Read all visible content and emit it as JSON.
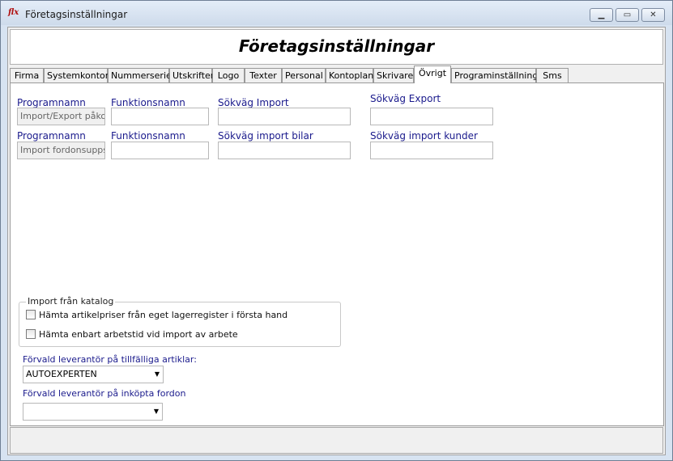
{
  "window": {
    "title": "Företagsinställningar",
    "icon_text": "flx"
  },
  "header": {
    "title": "Företagsinställningar"
  },
  "tabs": [
    {
      "label": "Firma"
    },
    {
      "label": "Systemkonton"
    },
    {
      "label": "Nummerserier"
    },
    {
      "label": "Utskrifter"
    },
    {
      "label": "Logo"
    },
    {
      "label": "Texter"
    },
    {
      "label": "Personal"
    },
    {
      "label": "Kontoplan"
    },
    {
      "label": "Skrivare"
    },
    {
      "label": "Övrigt"
    },
    {
      "label": "Programinställningar"
    },
    {
      "label": "Sms"
    }
  ],
  "active_tab": "Övrigt",
  "row1": {
    "programnamn_label": "Programnamn",
    "programnamn_value": "Import/Export påko",
    "funktionsnamn_label": "Funktionsnamn",
    "funktionsnamn_value": "",
    "import_label": "Sökväg Import",
    "import_value": "",
    "export_label": "Sökväg Export",
    "export_value": ""
  },
  "row2": {
    "programnamn_label": "Programnamn",
    "programnamn_value": "Import fordonsupps",
    "funktionsnamn_label": "Funktionsnamn",
    "funktionsnamn_value": "",
    "import_bilar_label": "Sökväg import bilar",
    "import_bilar_value": "",
    "import_kunder_label": "Sökväg import kunder",
    "import_kunder_value": ""
  },
  "catalog": {
    "title": "Import från katalog",
    "check1": "Hämta artikelpriser från eget lagerregister i första hand",
    "check2": "Hämta enbart arbetstid vid import av arbete"
  },
  "supplier_temp": {
    "label": "Förvald leverantör på tillfälliga artiklar:",
    "value": "AUTOEXPERTEN"
  },
  "supplier_vehicle": {
    "label": "Förvald leverantör på inköpta fordon",
    "value": ""
  }
}
